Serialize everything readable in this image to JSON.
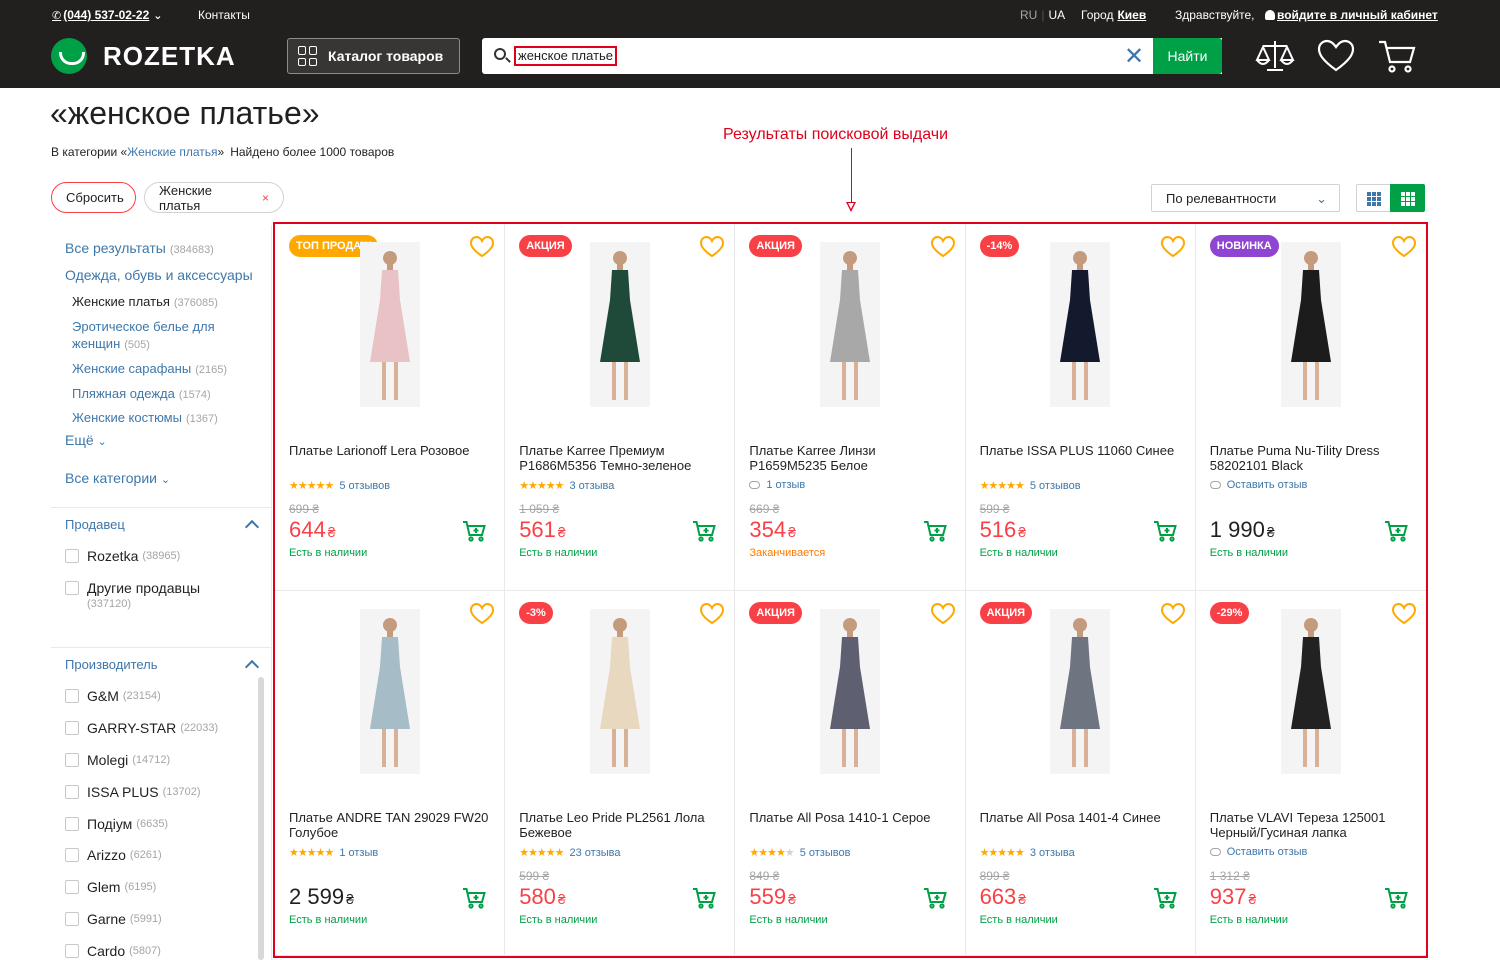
{
  "header": {
    "phone": "(044) 537-02-22",
    "contacts": "Контакты",
    "lang_ru": "RU",
    "lang_ua": "UA",
    "city_label": "Город",
    "city": "Киев",
    "greeting": "Здравствуйте,",
    "login": "войдите в личный кабинет",
    "logo": "ROZETKA",
    "catalog": "Каталог товаров",
    "search_value": "женское платье",
    "search_button": "Найти",
    "colors": {
      "bg": "#221f1f",
      "green": "#00a046",
      "link": "#3e77aa",
      "red": "#f84147"
    }
  },
  "page": {
    "title": "«женское платье»",
    "in_category": "В категории «",
    "category_link": "Женские платья",
    "category_close": "»",
    "found": "Найдено более 1000 товаров",
    "annotation": "Результаты поисковой выдачи"
  },
  "filters": {
    "reset": "Сбросить",
    "active": "Женские платья",
    "remove": "×",
    "sort": "По релевантности"
  },
  "sidebar": {
    "categories": [
      {
        "label": "Все результаты",
        "count": "(384683)"
      },
      {
        "label": "Одежда, обувь и аксессуары",
        "count": ""
      }
    ],
    "subcategories": [
      {
        "label": "Женские платья",
        "count": "(376085)"
      },
      {
        "label": "Эротическое белье для женщин",
        "count": "(505)"
      },
      {
        "label": "Женские сарафаны",
        "count": "(2165)"
      },
      {
        "label": "Пляжная одежда",
        "count": "(1574)"
      },
      {
        "label": "Женские костюмы",
        "count": "(1367)"
      }
    ],
    "more": "Ещё",
    "all_categories": "Все категории",
    "seller_title": "Продавец",
    "sellers": [
      {
        "label": "Rozetka",
        "count": "(38965)"
      },
      {
        "label": "Другие продавцы",
        "count": "(337120)"
      }
    ],
    "brand_title": "Производитель",
    "brands": [
      {
        "label": "G&M",
        "count": "(23154)"
      },
      {
        "label": "GARRY-STAR",
        "count": "(22033)"
      },
      {
        "label": "Molegi",
        "count": "(14712)"
      },
      {
        "label": "ISSA PLUS",
        "count": "(13702)"
      },
      {
        "label": "Подіум",
        "count": "(6635)"
      },
      {
        "label": "Arizzo",
        "count": "(6261)"
      },
      {
        "label": "Glem",
        "count": "(6195)"
      },
      {
        "label": "Garne",
        "count": "(5991)"
      },
      {
        "label": "Cardo",
        "count": "(5807)"
      }
    ]
  },
  "products": [
    {
      "badge": "ТОП ПРОДАЖ",
      "badge_color": "#ffa900",
      "title": "Платье Larionoff Lera Розовое",
      "stars": 5,
      "rating": 5,
      "reviews": "5 отзывов",
      "old": "699 ₴",
      "price": "644",
      "currency": "₴",
      "availability": "Есть в наличии",
      "low": false,
      "dress": "#e8c2c4"
    },
    {
      "badge": "АКЦИЯ",
      "badge_color": "#f84147",
      "title": "Платье Karree Премиум P1686M5356 Темно-зеленое",
      "stars": 5,
      "rating": 5,
      "reviews": "3 отзыва",
      "old": "1 059 ₴",
      "price": "561",
      "currency": "₴",
      "availability": "Есть в наличии",
      "low": false,
      "dress": "#1f4a3a"
    },
    {
      "badge": "АКЦИЯ",
      "badge_color": "#f84147",
      "title": "Платье Karree Линзи P1659M5235 Белое",
      "stars": 0,
      "rating": 0,
      "reviews": "1 отзыв",
      "old": "669 ₴",
      "price": "354",
      "currency": "₴",
      "availability": "Заканчивается",
      "low": true,
      "dress": "#a8a8a8"
    },
    {
      "badge": "-14%",
      "badge_color": "#f84147",
      "title": "Платье ISSA PLUS 11060 Синее",
      "stars": 5,
      "rating": 5,
      "reviews": "5 отзывов",
      "old": "599 ₴",
      "price": "516",
      "currency": "₴",
      "availability": "Есть в наличии",
      "low": false,
      "dress": "#141a2e"
    },
    {
      "badge": "НОВИНКА",
      "badge_color": "#8f44d2",
      "title": "Платье Puma Nu-Tility Dress 58202101 Black",
      "stars": 0,
      "rating": 0,
      "reviews": "Оставить отзыв",
      "old": "",
      "price": "1 990",
      "currency": "₴",
      "availability": "Есть в наличии",
      "low": false,
      "regular": true,
      "dress": "#1c1c1c"
    },
    {
      "badge": "",
      "badge_color": "",
      "title": "Платье ANDRE TAN 29029 FW20 Голубое",
      "stars": 5,
      "rating": 5,
      "reviews": "1 отзыв",
      "old": "",
      "price": "2 599",
      "currency": "₴",
      "availability": "Есть в наличии",
      "low": false,
      "regular": true,
      "dress": "#a6bcc6"
    },
    {
      "badge": "-3%",
      "badge_color": "#f84147",
      "title": "Платье Leo Pride PL2561 Лола Бежевое",
      "stars": 5,
      "rating": 5,
      "reviews": "23 отзыва",
      "old": "599 ₴",
      "price": "580",
      "currency": "₴",
      "availability": "Есть в наличии",
      "low": false,
      "dress": "#e9d8c0"
    },
    {
      "badge": "АКЦИЯ",
      "badge_color": "#f84147",
      "title": "Платье All Posa 1410-1 Серое",
      "stars": 5,
      "rating": 3.5,
      "reviews": "5 отзывов",
      "old": "849 ₴",
      "price": "559",
      "currency": "₴",
      "availability": "Есть в наличии",
      "low": false,
      "dress": "#5e6072"
    },
    {
      "badge": "АКЦИЯ",
      "badge_color": "#f84147",
      "title": "Платье All Posa 1401-4 Синее",
      "stars": 5,
      "rating": 5,
      "reviews": "3 отзыва",
      "old": "899 ₴",
      "price": "663",
      "currency": "₴",
      "availability": "Есть в наличии",
      "low": false,
      "dress": "#6f7580"
    },
    {
      "badge": "-29%",
      "badge_color": "#f84147",
      "title": "Платье VLAVI Тереза 125001 Черный/Гусиная лапка",
      "stars": 0,
      "rating": 0,
      "reviews": "Оставить отзыв",
      "old": "1 312 ₴",
      "price": "937",
      "currency": "₴",
      "availability": "Есть в наличии",
      "low": false,
      "dress": "#222222"
    }
  ]
}
